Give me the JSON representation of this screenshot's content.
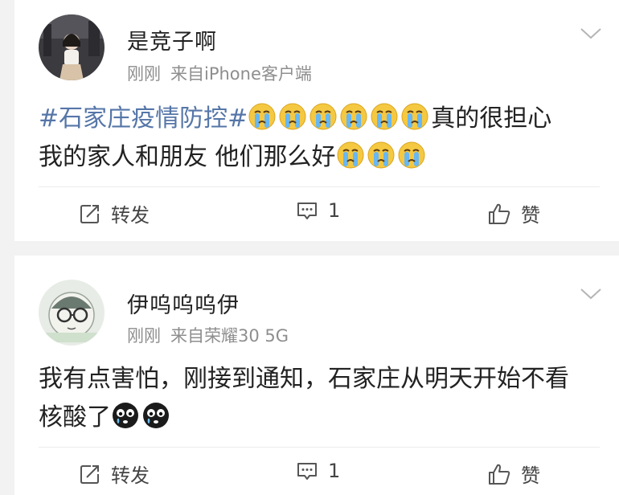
{
  "posts": [
    {
      "username": "是竞子啊",
      "time": "刚刚",
      "source": "来自iPhone客户端",
      "hashtag": "#石家庄疫情防控#",
      "line1": "真的很担心",
      "line2": "我的家人和朋友 他们那么好",
      "emoji_after_hashtag": "crying-face",
      "emoji_line2": "crying-face",
      "repost_label": "转发",
      "comment_count": "1",
      "like_label": "赞"
    },
    {
      "username": "伊呜呜呜伊",
      "time": "刚刚",
      "source": "来自荣耀30 5G",
      "line1": "我有点害怕，刚接到通知，石家庄从明天开始不看",
      "line2": "核酸了",
      "emoji_line2": "black-crying-face",
      "repost_label": "转发",
      "comment_count": "1",
      "like_label": "赞"
    }
  ],
  "colors": {
    "hashtag": "#5576a8",
    "meta_text": "#8e8e8e",
    "background": "#f2f2f2",
    "card": "#ffffff"
  }
}
